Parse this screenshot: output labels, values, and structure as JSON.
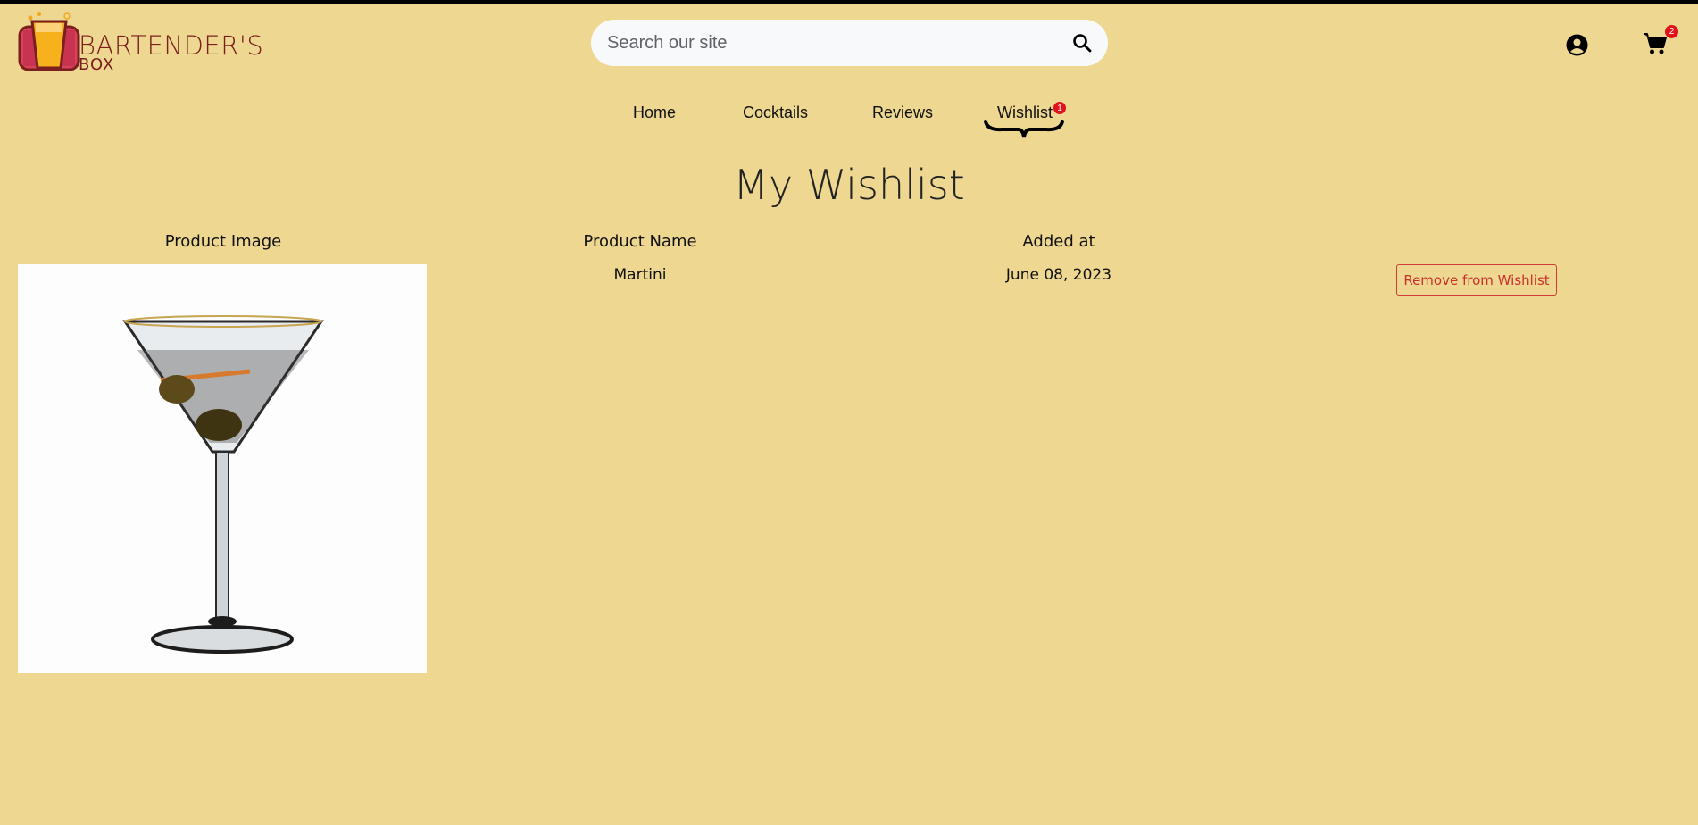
{
  "brand": {
    "line1": "BARTENDER'S",
    "line2": "BOX"
  },
  "search": {
    "placeholder": "Search our site"
  },
  "header": {
    "cart_count": "2"
  },
  "nav": {
    "items": [
      {
        "label": "Home"
      },
      {
        "label": "Cocktails"
      },
      {
        "label": "Reviews"
      },
      {
        "label": "Wishlist",
        "badge": "1"
      }
    ]
  },
  "page": {
    "title": "My Wishlist"
  },
  "table": {
    "headers": [
      "Product Image",
      "Product Name",
      "Added at"
    ],
    "rows": [
      {
        "name": "Martini",
        "added_at": "June 08, 2023",
        "action": "Remove from Wishlist"
      }
    ]
  },
  "colors": {
    "background": "#eed891",
    "badge": "#e3121a",
    "danger": "#c9302c",
    "brand": "#7a1e1e"
  },
  "icons": [
    "search-icon",
    "account-icon",
    "cart-icon",
    "martini-image"
  ]
}
